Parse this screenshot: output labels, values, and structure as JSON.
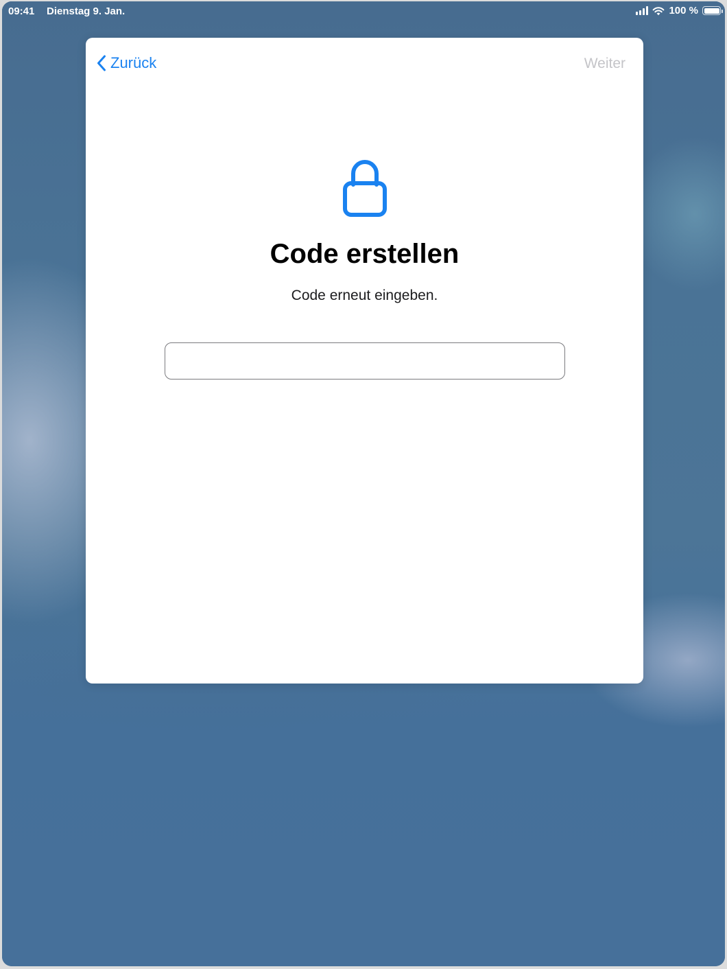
{
  "status_bar": {
    "time": "09:41",
    "date": "Dienstag 9. Jan.",
    "battery_text": "100 %",
    "signal_icon": "cellular-signal-icon",
    "wifi_icon": "wifi-icon",
    "battery_icon": "battery-icon",
    "battery_level": 1.0
  },
  "nav": {
    "back_label": "Zurück",
    "back_icon": "chevron-left-icon",
    "next_label": "Weiter"
  },
  "content": {
    "icon": "lock-icon",
    "title": "Code erstellen",
    "subtitle": "Code erneut eingeben.",
    "code_value": ""
  },
  "colors": {
    "accent": "#1a82f0",
    "disabled": "#c4c4c8",
    "background": "#4a6f94"
  }
}
